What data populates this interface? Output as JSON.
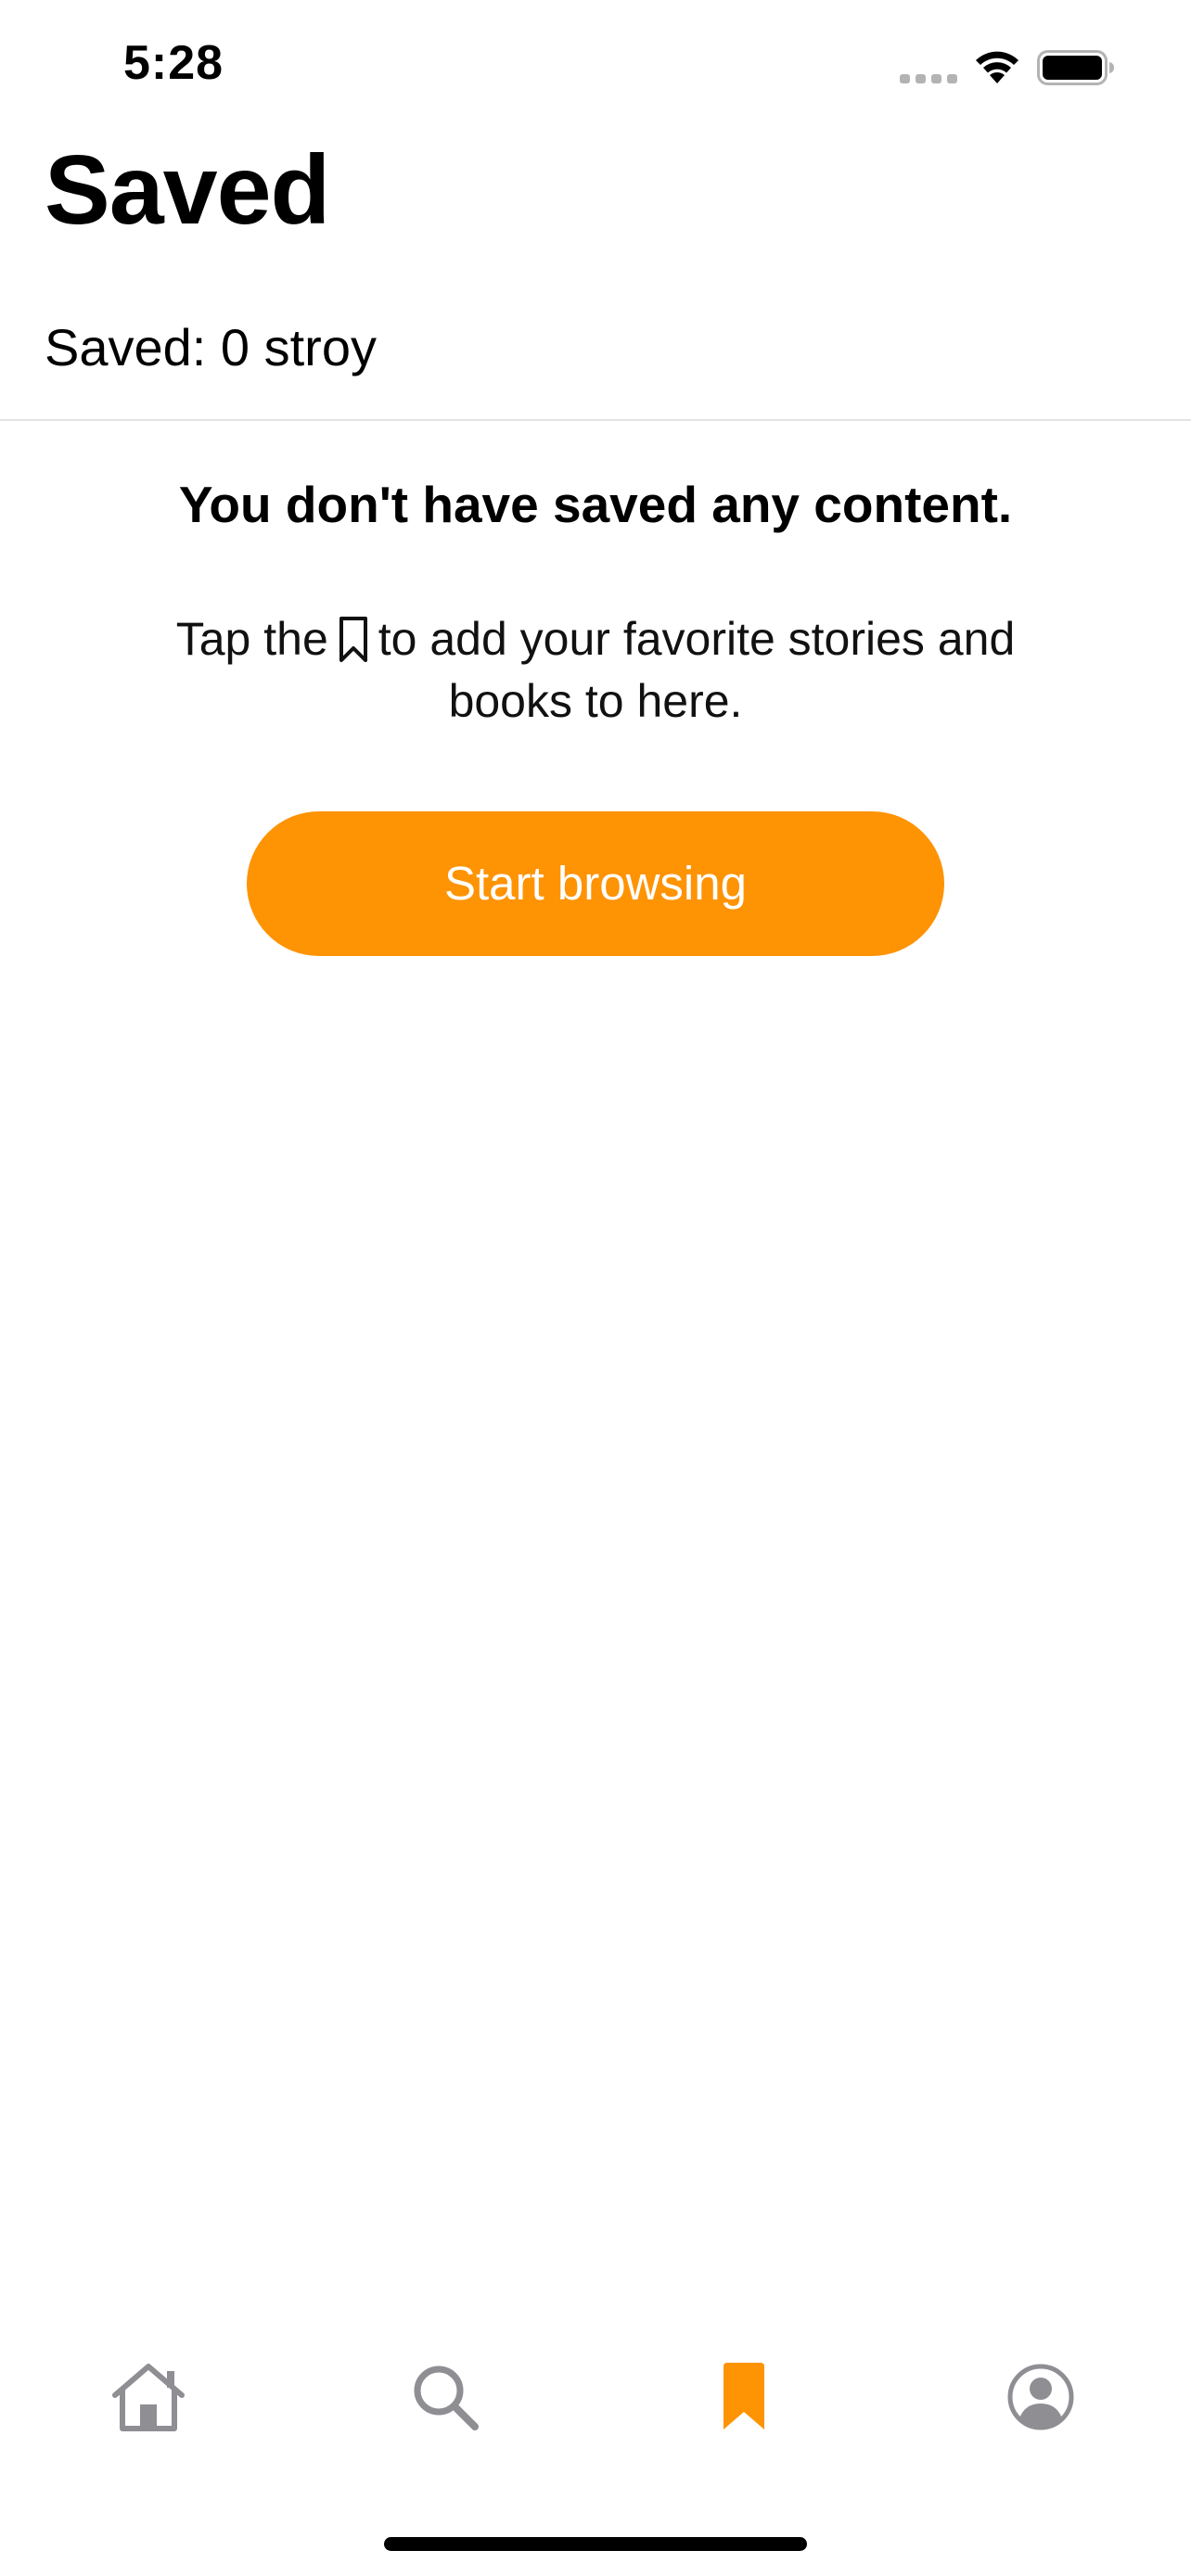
{
  "status_bar": {
    "time": "5:28"
  },
  "header": {
    "title": "Saved",
    "saved_count": "Saved: 0 stroy"
  },
  "empty_state": {
    "heading": "You don't have saved any content.",
    "desc_before_icon": "Tap the",
    "desc_after_icon": "to add your favorite stories and books to here.",
    "inline_icon": "bookmark-outline-icon",
    "button_label": "Start browsing"
  },
  "tab_bar": {
    "items": [
      {
        "name": "home",
        "icon": "home-icon",
        "active": false
      },
      {
        "name": "search",
        "icon": "search-icon",
        "active": false
      },
      {
        "name": "saved",
        "icon": "bookmark-icon",
        "active": true
      },
      {
        "name": "profile",
        "icon": "profile-icon",
        "active": false
      }
    ]
  },
  "colors": {
    "accent": "#fe9304",
    "inactive_icon": "#8e8e93",
    "divider": "#e3e3e3"
  }
}
